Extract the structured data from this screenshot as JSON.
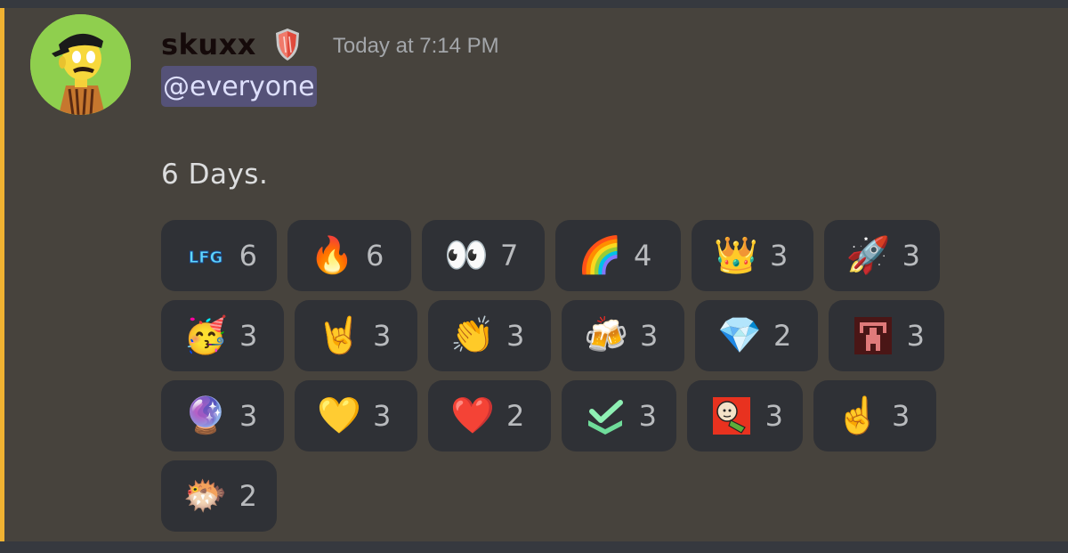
{
  "message": {
    "author": "skuxx",
    "timestamp": "Today at 7:14 PM",
    "mention": "@everyone",
    "text": "6 Days.",
    "accent_color": "#f0b232",
    "mention_bg": "#555278",
    "author_color": "#150a0a"
  },
  "reactions": [
    {
      "emoji": "lfg-custom-emoji",
      "glyph": "",
      "count": "6"
    },
    {
      "emoji": "fire-emoji",
      "glyph": "🔥",
      "count": "6"
    },
    {
      "emoji": "eyes-emoji",
      "glyph": "👀",
      "count": "7"
    },
    {
      "emoji": "rainbow-emoji",
      "glyph": "🌈",
      "count": "4"
    },
    {
      "emoji": "crown-emoji",
      "glyph": "👑",
      "count": "3"
    },
    {
      "emoji": "rocket-emoji",
      "glyph": "🚀",
      "count": "3"
    },
    {
      "emoji": "partying-face-emoji",
      "glyph": "🥳",
      "count": "3"
    },
    {
      "emoji": "sign-of-horns-emoji",
      "glyph": "🤘",
      "count": "3"
    },
    {
      "emoji": "clapping-hands-emoji",
      "glyph": "👏",
      "count": "3"
    },
    {
      "emoji": "beer-mugs-emoji",
      "glyph": "🍻",
      "count": "3"
    },
    {
      "emoji": "gem-emoji",
      "glyph": "💎",
      "count": "2"
    },
    {
      "emoji": "pixel-weightlifter-custom-emoji",
      "glyph": "",
      "count": "3"
    },
    {
      "emoji": "crystal-ball-emoji",
      "glyph": "🔮",
      "count": "3"
    },
    {
      "emoji": "yellow-heart-emoji",
      "glyph": "💛",
      "count": "3"
    },
    {
      "emoji": "red-heart-emoji",
      "glyph": "❤️",
      "count": "2"
    },
    {
      "emoji": "green-check-custom-emoji",
      "glyph": "",
      "count": "3"
    },
    {
      "emoji": "cartoon-face-custom-emoji",
      "glyph": "",
      "count": "3"
    },
    {
      "emoji": "pointing-up-emoji",
      "glyph": "☝️",
      "count": "3"
    },
    {
      "emoji": "fish-face-custom-emoji",
      "glyph": "🐡",
      "count": "2"
    }
  ]
}
